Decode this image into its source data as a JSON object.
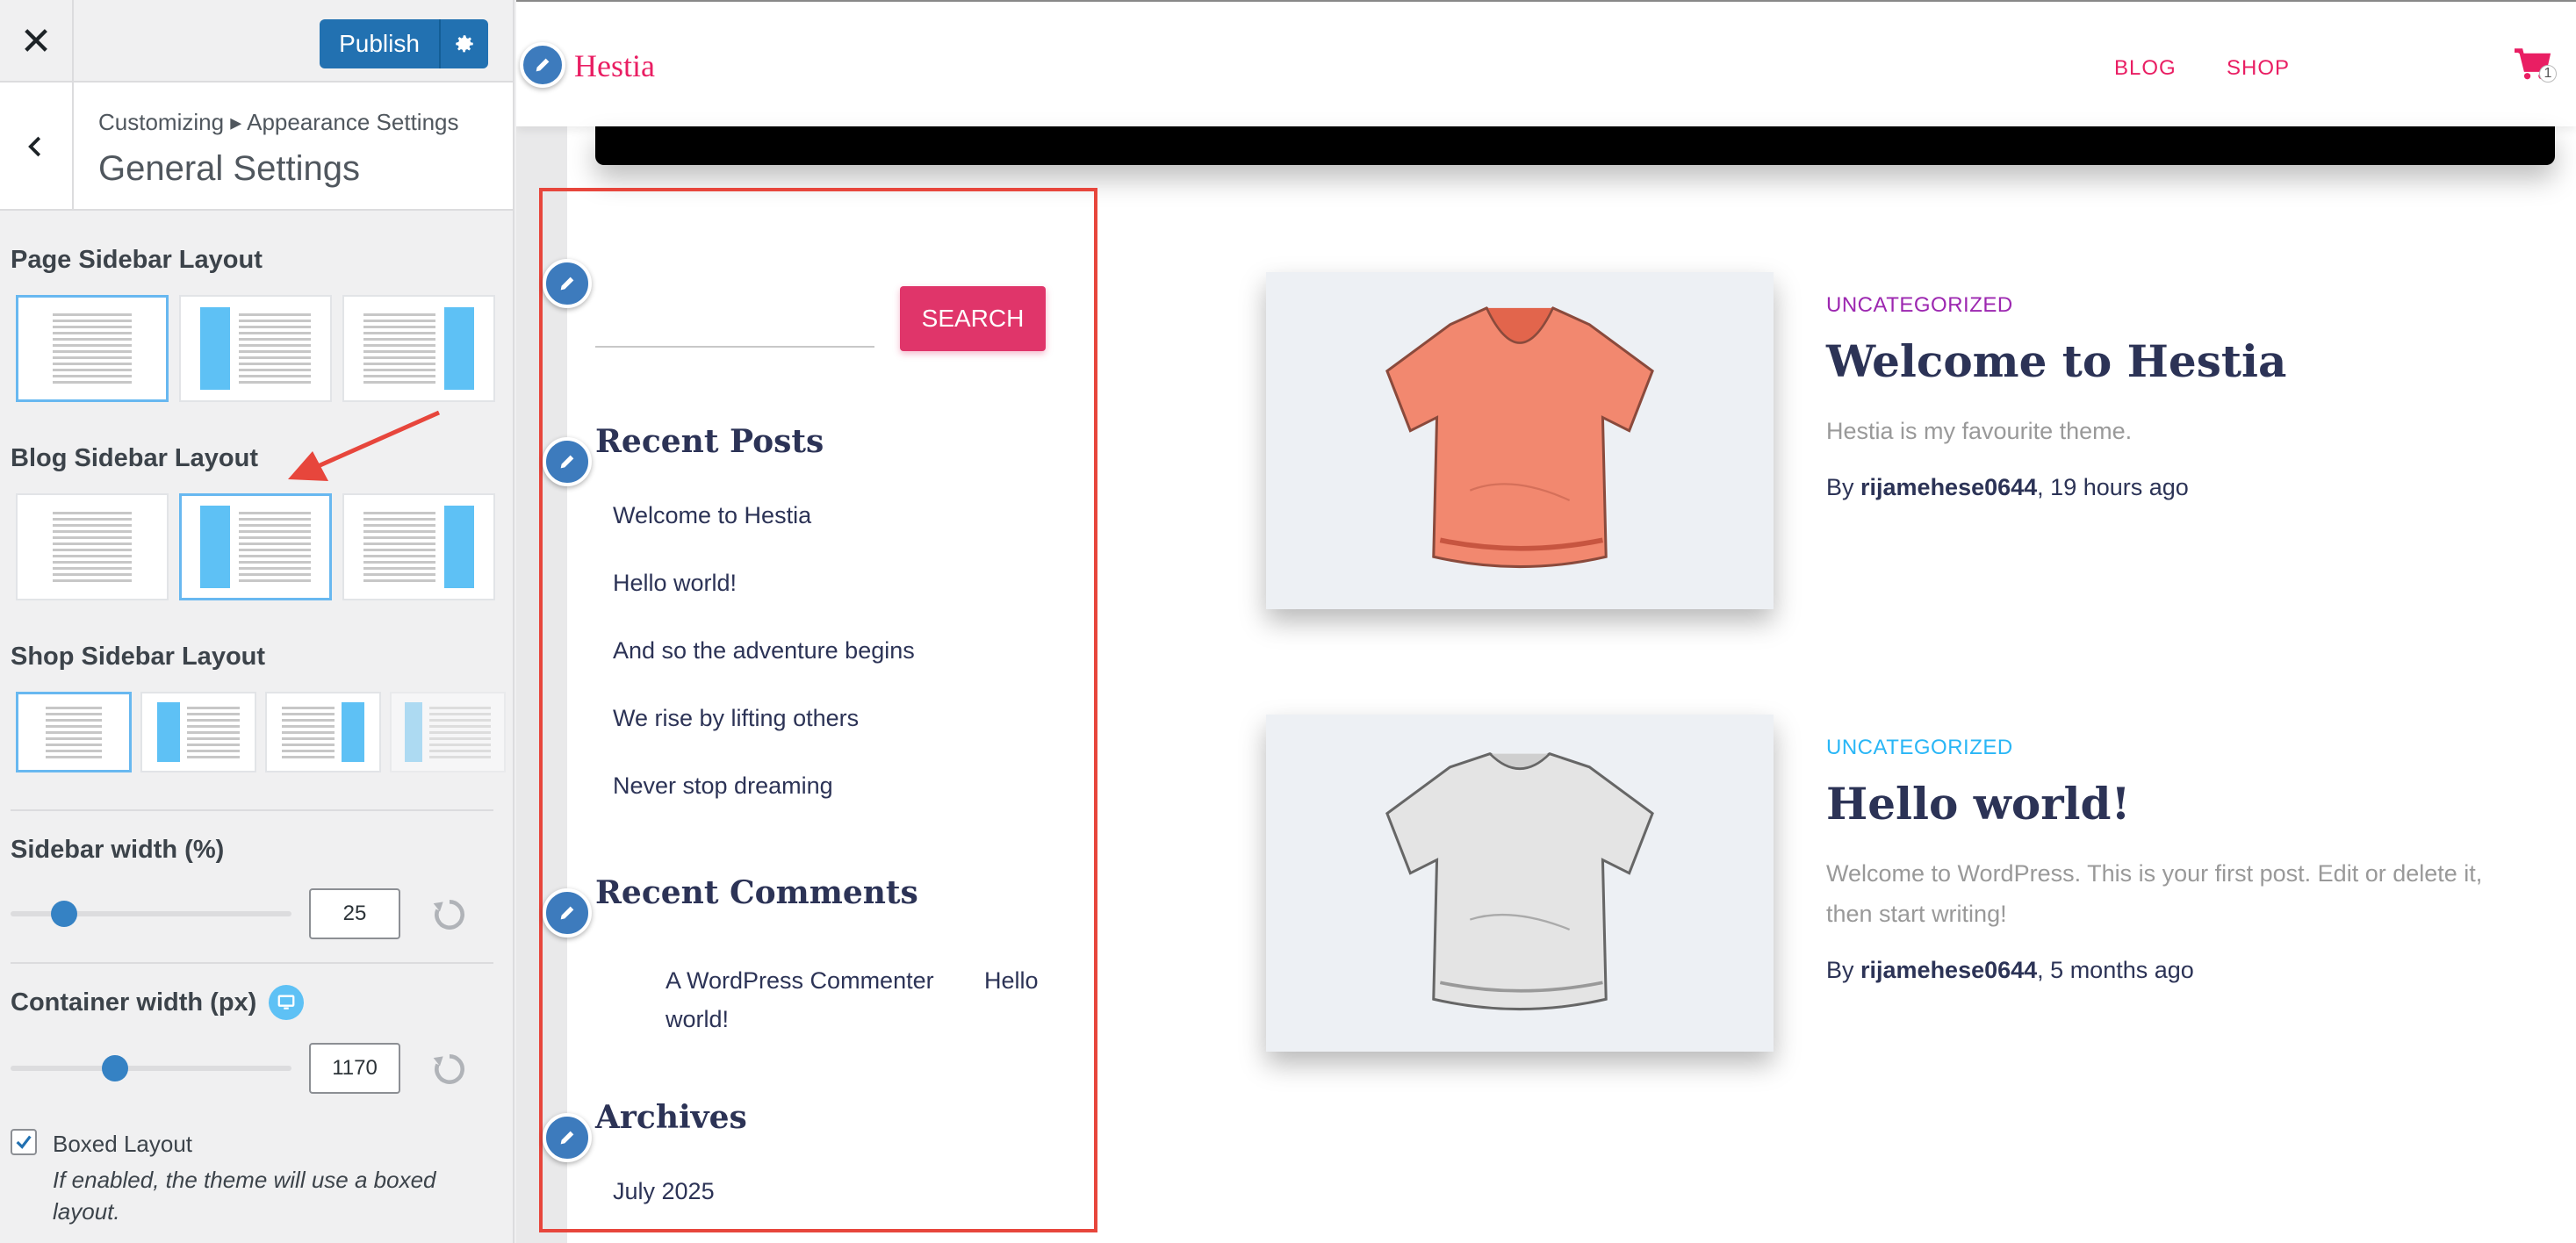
{
  "customizer": {
    "close_glyph": "✕",
    "publish_label": "Publish",
    "breadcrumb": "Customizing ▸ Appearance Settings",
    "section_title": "General Settings",
    "page_sidebar_label": "Page Sidebar Layout",
    "blog_sidebar_label": "Blog Sidebar Layout",
    "shop_sidebar_label": "Shop Sidebar Layout",
    "sidebar_width_label": "Sidebar width (%)",
    "sidebar_width_value": "25",
    "container_width_label": "Container width (px)",
    "container_width_value": "1170",
    "boxed_layout_label": "Boxed Layout",
    "boxed_layout_checked": true,
    "boxed_layout_desc": "If enabled, the theme will use a boxed layout.",
    "selected": {
      "page": "full-width",
      "blog": "left-sidebar",
      "shop": "full-width"
    },
    "accent_color": "#2271b1"
  },
  "site": {
    "title": "Hestia",
    "nav": [
      "BLOG",
      "SHOP"
    ],
    "cart_count": "1",
    "brand_color": "#e91e63"
  },
  "sidebar": {
    "search_button": "SEARCH",
    "recent_posts_title": "Recent Posts",
    "recent_posts": [
      "Welcome to Hestia",
      "Hello world!",
      "And so the adventure begins",
      "We rise by lifting others",
      "Never stop dreaming"
    ],
    "recent_comments_title": "Recent Comments",
    "comment_author": "A WordPress Commenter",
    "comment_on": "Hello",
    "comment_on_line2": "world!",
    "archives_title": "Archives",
    "archives": [
      "July 2025"
    ]
  },
  "posts": [
    {
      "category": "UNCATEGORIZED",
      "category_color": "#9c27b0",
      "title": "Welcome to Hestia",
      "excerpt": "Hestia is my favourite theme.",
      "by": "By ",
      "author": "rijamehese0644",
      "time": ", 19 hours ago",
      "image": "orange-tshirt"
    },
    {
      "category": "UNCATEGORIZED",
      "category_color": "#29b6f6",
      "title": "Hello world!",
      "excerpt": "Welcome to WordPress. This is your first post. Edit or delete it, then start writing!",
      "by": "By ",
      "author": "rijamehese0644",
      "time": ", 5 months ago",
      "image": "white-tshirt"
    }
  ]
}
